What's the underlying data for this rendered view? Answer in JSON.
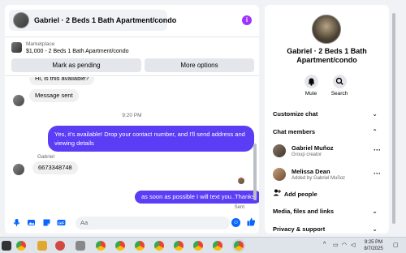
{
  "header": {
    "title": "Gabriel · 2 Beds 1 Bath Apartment/condo",
    "info_icon": "info-icon"
  },
  "listing": {
    "category": "Marketplace",
    "title": "$1,000 - 2 Beds 1 Bath Apartment/condo",
    "mark_pending_label": "Mark as pending",
    "more_options_label": "More options"
  },
  "messages": {
    "partial_in": "Hi, is this available?",
    "in_1": "Message sent",
    "timestamp": "9:20 PM",
    "out_1": "Yes, it's available! Drop your contact number, and I'll send address and viewing details",
    "sender_name": "Gabriel",
    "in_2": "6673348748",
    "out_2": "as soon as possible I will text you..Thanks",
    "sent_label": "Sent"
  },
  "composer": {
    "placeholder": "Aa",
    "icons": [
      "microphone-icon",
      "photo-icon",
      "sticker-icon",
      "gif-icon",
      "emoji-icon",
      "like-icon"
    ]
  },
  "side": {
    "title": "Gabriel · 2 Beds 1 Bath Apartment/condo",
    "mute_label": "Mute",
    "search_label": "Search",
    "customize_chat": "Customize chat",
    "chat_members": "Chat members",
    "members": [
      {
        "name": "Gabriel Muñoz",
        "role": "Group creator"
      },
      {
        "name": "Melissa Dean",
        "role": "Added by Gabriel Muñoz"
      }
    ],
    "add_people": "Add people",
    "media_files": "Media, files and links",
    "privacy": "Privacy & support"
  },
  "taskbar": {
    "time": "9:25 PM",
    "date": "8/7/2025"
  },
  "colors": {
    "accent": "#5b3df5",
    "messenger_blue": "#0866ff",
    "info_purple": "#a033ff"
  }
}
